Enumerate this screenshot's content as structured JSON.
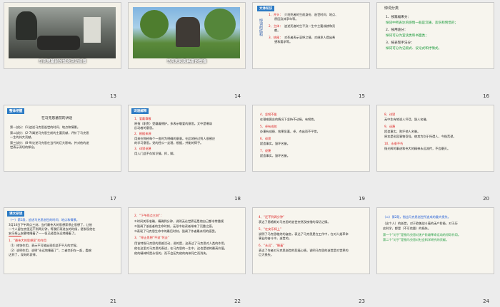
{
  "slides": [
    {
      "number": "13",
      "caption": "马克思墓前的悼念活动场景"
    },
    {
      "number": "14",
      "caption": "马克思和恩格斯的塑像"
    },
    {
      "number": "15",
      "tag": "文体知识",
      "side": "悼词的结构",
      "lines": [
        {
          "mark": "1、开头：",
          "text": "介绍死者的生前身份、逝世时间、地点、"
        },
        {
          "text": "原因及其享年等。"
        },
        {
          "mark": "2、主体：",
          "text": "追述死者的生平及一生中主要成就和贡"
        },
        {
          "text": "献。"
        },
        {
          "mark": "3、结尾：",
          "text": "对死者表示哀悼之情，对继承人提出希"
        },
        {
          "text": "望和要求等。"
        }
      ]
    },
    {
      "number": "16",
      "title": "悼词分类",
      "lines": [
        {
          "text": "1、按篇幅来分："
        },
        {
          "text": "悼词中所表达的感情一般是沉痛、悲伤和惋惜的；"
        },
        {
          "text": "2、按用途分："
        },
        {
          "text": "悼词可分为宣读类和书面类；"
        },
        {
          "text": "3、按表现手法分："
        },
        {
          "text": "悼词可分为记叙式、议论式和抒情式。"
        }
      ]
    },
    {
      "number": "17",
      "tag": "整体把握",
      "title": "在马克思墓前的讲话",
      "lines": [
        {
          "text": "第一部分：(1)追述马克思逝世的时间、地点和情景。"
        },
        {
          "text": "第二部分：(2-7)阐述马克思生前的主要贡献，评价了马克思"
        },
        {
          "text": "一生的伟大贡献。"
        },
        {
          "text": "第三部分：(8-9)论述马克思在当代的巨大影响，并对他的逝"
        },
        {
          "text": "世表示深切的悼念。"
        }
      ]
    },
    {
      "number": "18",
      "tag": "词语解释",
      "lines": [
        {
          "text": "1、爱戴尊敬"
        },
        {
          "text": "原指（职责）受戴着拥护。多表示敬爱的意思。文中是嘲讽"
        },
        {
          "text": "反动者的意思。"
        },
        {
          "text": "2、根据来源"
        },
        {
          "text": "用来在物经每个一变时为明确的意意。在此地经过到人很感应"
        },
        {
          "text": "的学习意思。党的经公一定理，根据，并能的得子。"
        },
        {
          "text": "3、诽谤诬蔑"
        },
        {
          "text": "用入门此不存知识情，挥，脚。"
        }
      ]
    },
    {
      "number": "19",
      "lines": [
        {
          "text": "4、坚韧不拔"
        },
        {
          "text": "在艰难困苦的情况下坚持不动摇，有韧性。"
        },
        {
          "text": "5、卓有成效"
        },
        {
          "text": "办事有成绩、效果显著，卓，杰出而不平常。"
        },
        {
          "text": "6、诽谤"
        },
        {
          "text": "捏造事实，毁坏名誉。"
        },
        {
          "text": "7、诬蔑"
        },
        {
          "text": "捏造事实，毁坏名誉。"
        }
      ]
    },
    {
      "number": "20",
      "lines": [
        {
          "text": "8、诽谤"
        },
        {
          "text": "无中生有地说人坏话，毁人名誉。"
        },
        {
          "text": "9、诬蔑"
        },
        {
          "text": "捏造事实，败坏他人名誉。"
        },
        {
          "text": "原本是形容事物奇怪，使其为别于所谓人，今指荒谬。"
        },
        {
          "text": "10、永垂不朽"
        },
        {
          "text": "指光辉的事迹和伟大的精神永远流传，不会磨灭。"
        }
      ]
    },
    {
      "number": "21",
      "tag": "课文研读",
      "lines": [
        {
          "text": "（一）第1段，追述马克思逝世的时间、地点和情景。"
        },
        {
          "text": "3月14日下午两点三刻，当代最伟大的思想家停止思想了，让他"
        },
        {
          "text": "一个人留在房里还不到两分钟，等我们再进去的时候，便发现他在"
        },
        {
          "text": "安乐椅上安静地睡着了——但已经是永远地睡着了。"
        },
        {
          "text": "1、“最伟大的思想家”的作用"
        },
        {
          "text": "（1）修饰作用，表示不可能出现如此不平凡的才智。"
        },
        {
          "text": "（2）说明作用，说明“永远地睡着了”，二者交织在一起，委婉"
        },
        {
          "text": "达到了，深刻的哀悼。"
        }
      ]
    },
    {
      "number": "22",
      "lines": [
        {
          "text": "2、“下午两点三刻”："
        },
        {
          "text": "①时间关系准确，精确到分钟，说明无论世界还是他自己都非常重视"
        },
        {
          "text": "②强调了该逝者的生命时刻，无形中给读者带来了沉重之感。"
        },
        {
          "text": "③表现了马克思生命中的最后时刻，强调了作者最亲切的感受。"
        },
        {
          "text": "3、“停止思想”不说“死去”"
        },
        {
          "text": "用该特指马克思的思维活动，说的是，这表达了马克思对人类的作用，"
        },
        {
          "text": "他在这里对马克思的表述，在马克思的一生中，这也是他的最高价值。"
        },
        {
          "text": "他的精神将是永恒的，而不会因为他的肉体死亡而消失。"
        }
      ]
    },
    {
      "number": "23",
      "lines": [
        {
          "text": "4、“还不到两分钟”"
        },
        {
          "text": "表达了恩格斯对马克思的逝世突然及惋惜的深切之情。"
        },
        {
          "text": "5、“在安乐椅上”"
        },
        {
          "text": "说明了马克思临终的姿态，表达了马克思是在工作中，在对人类革命"
        },
        {
          "text": "事业的奋斗中，逝世的。"
        },
        {
          "text": "6、“永远”、“睡着”"
        },
        {
          "text": "表达了作者对马克思逝世的悲痛心情，说明马克思的逝世是对世界的"
        },
        {
          "text": "巨大损失。"
        }
      ]
    },
    {
      "number": "24",
      "lines": [
        {
          "text": "（二）第2段，指出马克思逝世所造成的重大损失。"
        },
        {
          "text": "（这个人）的逝世，对于欧美战斗着的无产阶级，对于历"
        },
        {
          "text": "史科学，都是（不可估量）的损失。"
        },
        {
          "text": "第一个“对于”是指马克思对无产阶级革命运动的领导作用。"
        },
        {
          "text": "第二个“对于”是指马克思对社会科学研究的贡献。"
        }
      ]
    }
  ]
}
